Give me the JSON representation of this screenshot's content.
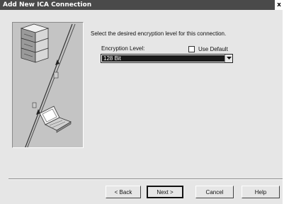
{
  "window": {
    "title": "Add New ICA Connection",
    "close_glyph": "x"
  },
  "content": {
    "instruction": "Select the desired encryption level for this connection.",
    "encryption_label": "Encryption Level:",
    "use_default_label": "Use Default",
    "use_default_checked": false,
    "encryption_selected": "128 Bit"
  },
  "buttons": {
    "back": "< Back",
    "next": "Next >",
    "cancel": "Cancel",
    "help": "Help"
  },
  "icons": {
    "illustration": "server-network-laptop-illustration",
    "dropdown": "chevron-down-icon"
  }
}
